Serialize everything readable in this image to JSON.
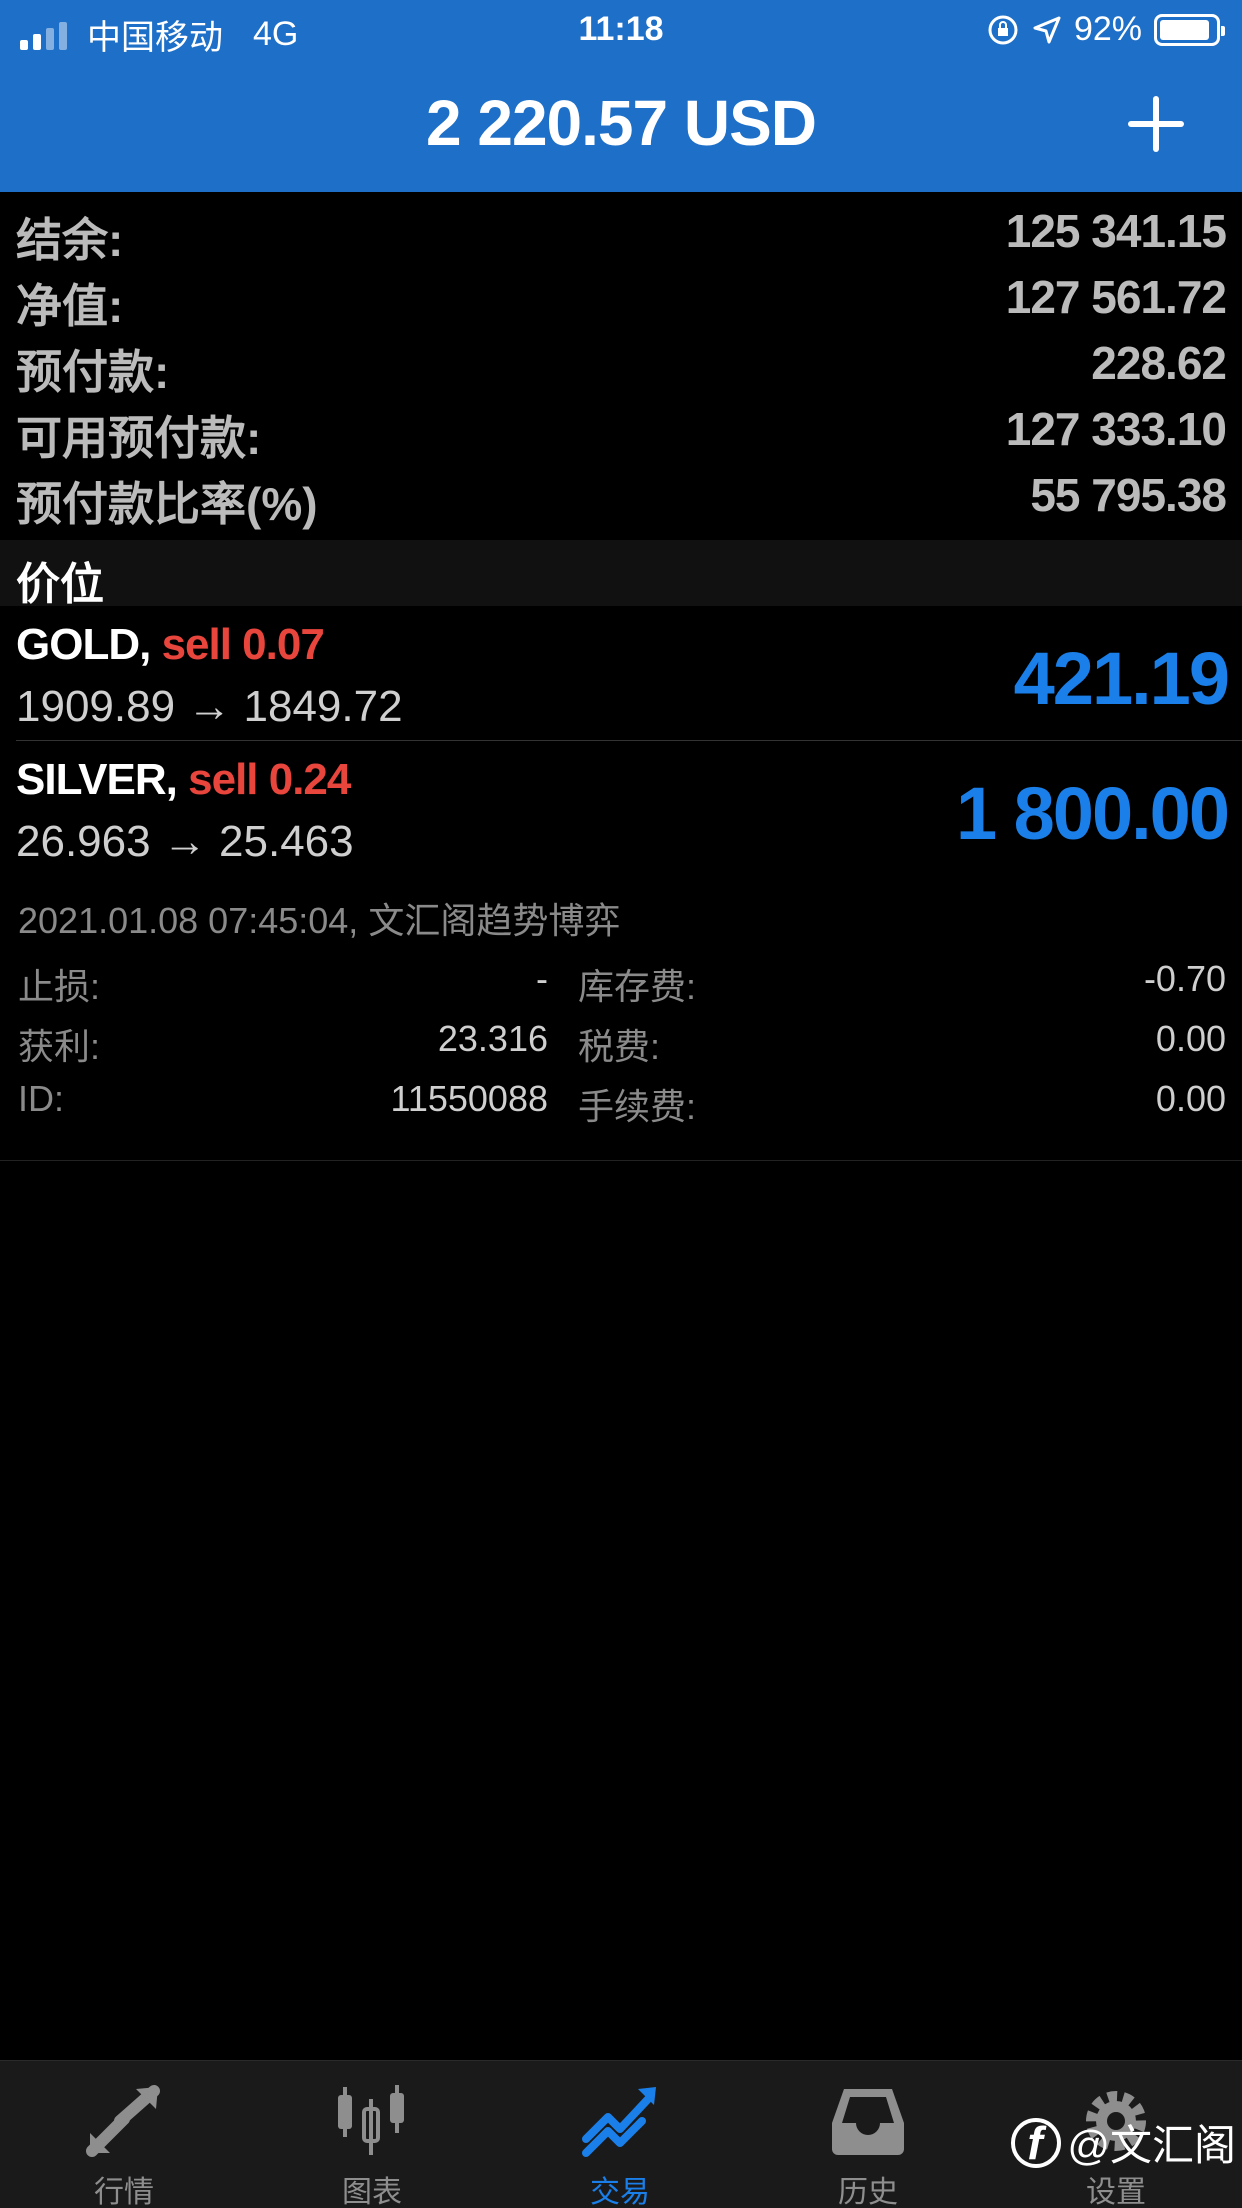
{
  "status_bar": {
    "carrier": "中国移动",
    "network": "4G",
    "time": "11:18",
    "battery": "92%"
  },
  "header": {
    "title": "2 220.57 USD",
    "add_icon": "plus-icon"
  },
  "summary": [
    {
      "label": "结余:",
      "value": "125 341.15"
    },
    {
      "label": "净值:",
      "value": "127 561.72"
    },
    {
      "label": "预付款:",
      "value": "228.62"
    },
    {
      "label": "可用预付款:",
      "value": "127 333.10"
    },
    {
      "label": "预付款比率(%)",
      "value": "55 795.38"
    }
  ],
  "section_title": "价位",
  "positions": [
    {
      "symbol": "GOLD,",
      "side": "sell 0.07",
      "prices": "1909.89 → 1849.72",
      "profit": "421.19"
    },
    {
      "symbol": "SILVER,",
      "side": "sell 0.24",
      "prices": "26.963 → 25.463",
      "profit": "1 800.00"
    }
  ],
  "selected_detail": {
    "meta": "2021.01.08 07:45:04, 文汇阁趋势博弈",
    "rows": [
      {
        "l1": "止损:",
        "v1": "-",
        "l2": "库存费:",
        "v2": "-0.70"
      },
      {
        "l1": "获利:",
        "v1": "23.316",
        "l2": "税费:",
        "v2": "0.00"
      },
      {
        "l1": "ID:",
        "v1": "11550088",
        "l2": "手续费:",
        "v2": "0.00"
      }
    ]
  },
  "tabs": [
    {
      "label": "行情",
      "icon": "quotes-arrows-icon"
    },
    {
      "label": "图表",
      "icon": "candlestick-chart-icon"
    },
    {
      "label": "交易",
      "icon": "trade-trend-icon",
      "active": true
    },
    {
      "label": "历史",
      "icon": "history-inbox-icon"
    },
    {
      "label": "设置",
      "icon": "gear-icon"
    }
  ],
  "watermark": "@文汇阁",
  "colors": {
    "header_blue": "#1e6fc8",
    "accent_blue": "#1a7fe8",
    "sell_red": "#e8453c"
  }
}
